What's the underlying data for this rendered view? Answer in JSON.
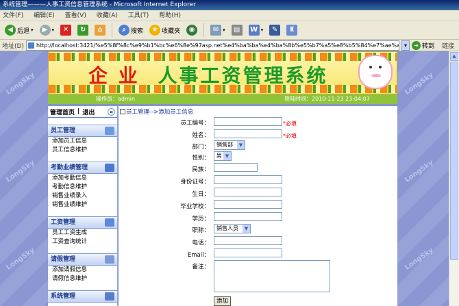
{
  "window": {
    "title": "系统管理———人事工资信息管理系统 - Microsoft Internet Explorer"
  },
  "menu": [
    "文件(F)",
    "编辑(E)",
    "查看(V)",
    "收藏(A)",
    "工具(T)",
    "帮助(H)"
  ],
  "toolbar": {
    "back": "后退",
    "search": "搜索",
    "favorites": "收藏夹"
  },
  "address": {
    "label": "地址(D)",
    "url": "http://localhost:3421/%e5%8f%8c%e9%b1%bc%e6%8e%97asp.net%e4%ba%ba%e4%ba%8b%e5%b7%a5%e8%b5%84%e7%ae%a1%e7%90%86%e7%b3%bb%e7%bb%9f/main.as",
    "go": "转到",
    "links": "链接"
  },
  "watermark": "LongSky",
  "banner": {
    "title_part1": "企 业",
    "title_part2": "人事工资管理系统"
  },
  "info": {
    "operator": "操作员：admin",
    "login_time": "登陆时间：2010-11-23 23:04:07"
  },
  "nav": {
    "home": "管理首页",
    "logout": "退出",
    "collapse": "«",
    "sections": [
      {
        "title": "员工管理",
        "items": [
          "添加员工信息",
          "员工信息维护"
        ]
      },
      {
        "title": "考勤业绩管理",
        "items": [
          "添加考勤信息",
          "考勤信息维护",
          "销售业绩录入",
          "销售业绩维护"
        ]
      },
      {
        "title": "工资管理",
        "items": [
          "员工工资生成",
          "工资查询统计"
        ]
      },
      {
        "title": "请假管理",
        "items": [
          "添加请假信息",
          "请假信息维护"
        ]
      },
      {
        "title": "系统管理",
        "items": []
      }
    ]
  },
  "breadcrumb": "员工管理-->添加员工信息",
  "form": {
    "emp_no": "员工编号：",
    "name": "姓名：",
    "dept": "部门：",
    "dept_value": "销售部",
    "gender": "性别：",
    "gender_value": "男",
    "nation": "民族：",
    "id_no": "身份证号：",
    "birthday": "生日：",
    "school": "毕业学校：",
    "education": "学历：",
    "position": "职称：",
    "position_value": "销售人员",
    "phone": "电话：",
    "email": "Email：",
    "remarks": "备注：",
    "required": "*必填",
    "submit": "添加"
  }
}
